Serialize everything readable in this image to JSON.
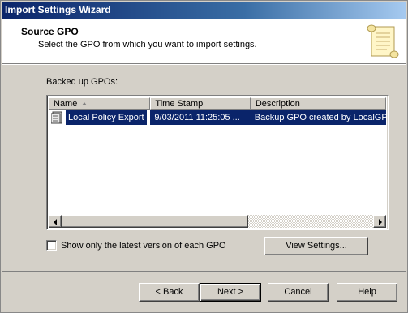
{
  "window": {
    "title": "Import Settings Wizard"
  },
  "header": {
    "title": "Source GPO",
    "subtitle": "Select the GPO from which you want to import settings.",
    "icon": "scroll-icon"
  },
  "list": {
    "label": "Backed up GPOs:",
    "columns": [
      {
        "label": "Name"
      },
      {
        "label": "Time Stamp"
      },
      {
        "label": "Description"
      }
    ],
    "rows": [
      {
        "name": "Local Policy Export",
        "timestamp": "9/03/2011 11:25:05 ...",
        "description": "Backup GPO created by LocalGPO",
        "selected": true,
        "icon": "gpo-icon"
      }
    ]
  },
  "options": {
    "latest_only_label": "Show only the latest version of each GPO",
    "latest_only_checked": false,
    "view_settings_label": "View Settings..."
  },
  "footer": {
    "back_label": "< Back",
    "next_label": "Next >",
    "cancel_label": "Cancel",
    "help_label": "Help"
  },
  "colors": {
    "selection": "#0a246a",
    "dialog_bg": "#d4d0c8"
  }
}
